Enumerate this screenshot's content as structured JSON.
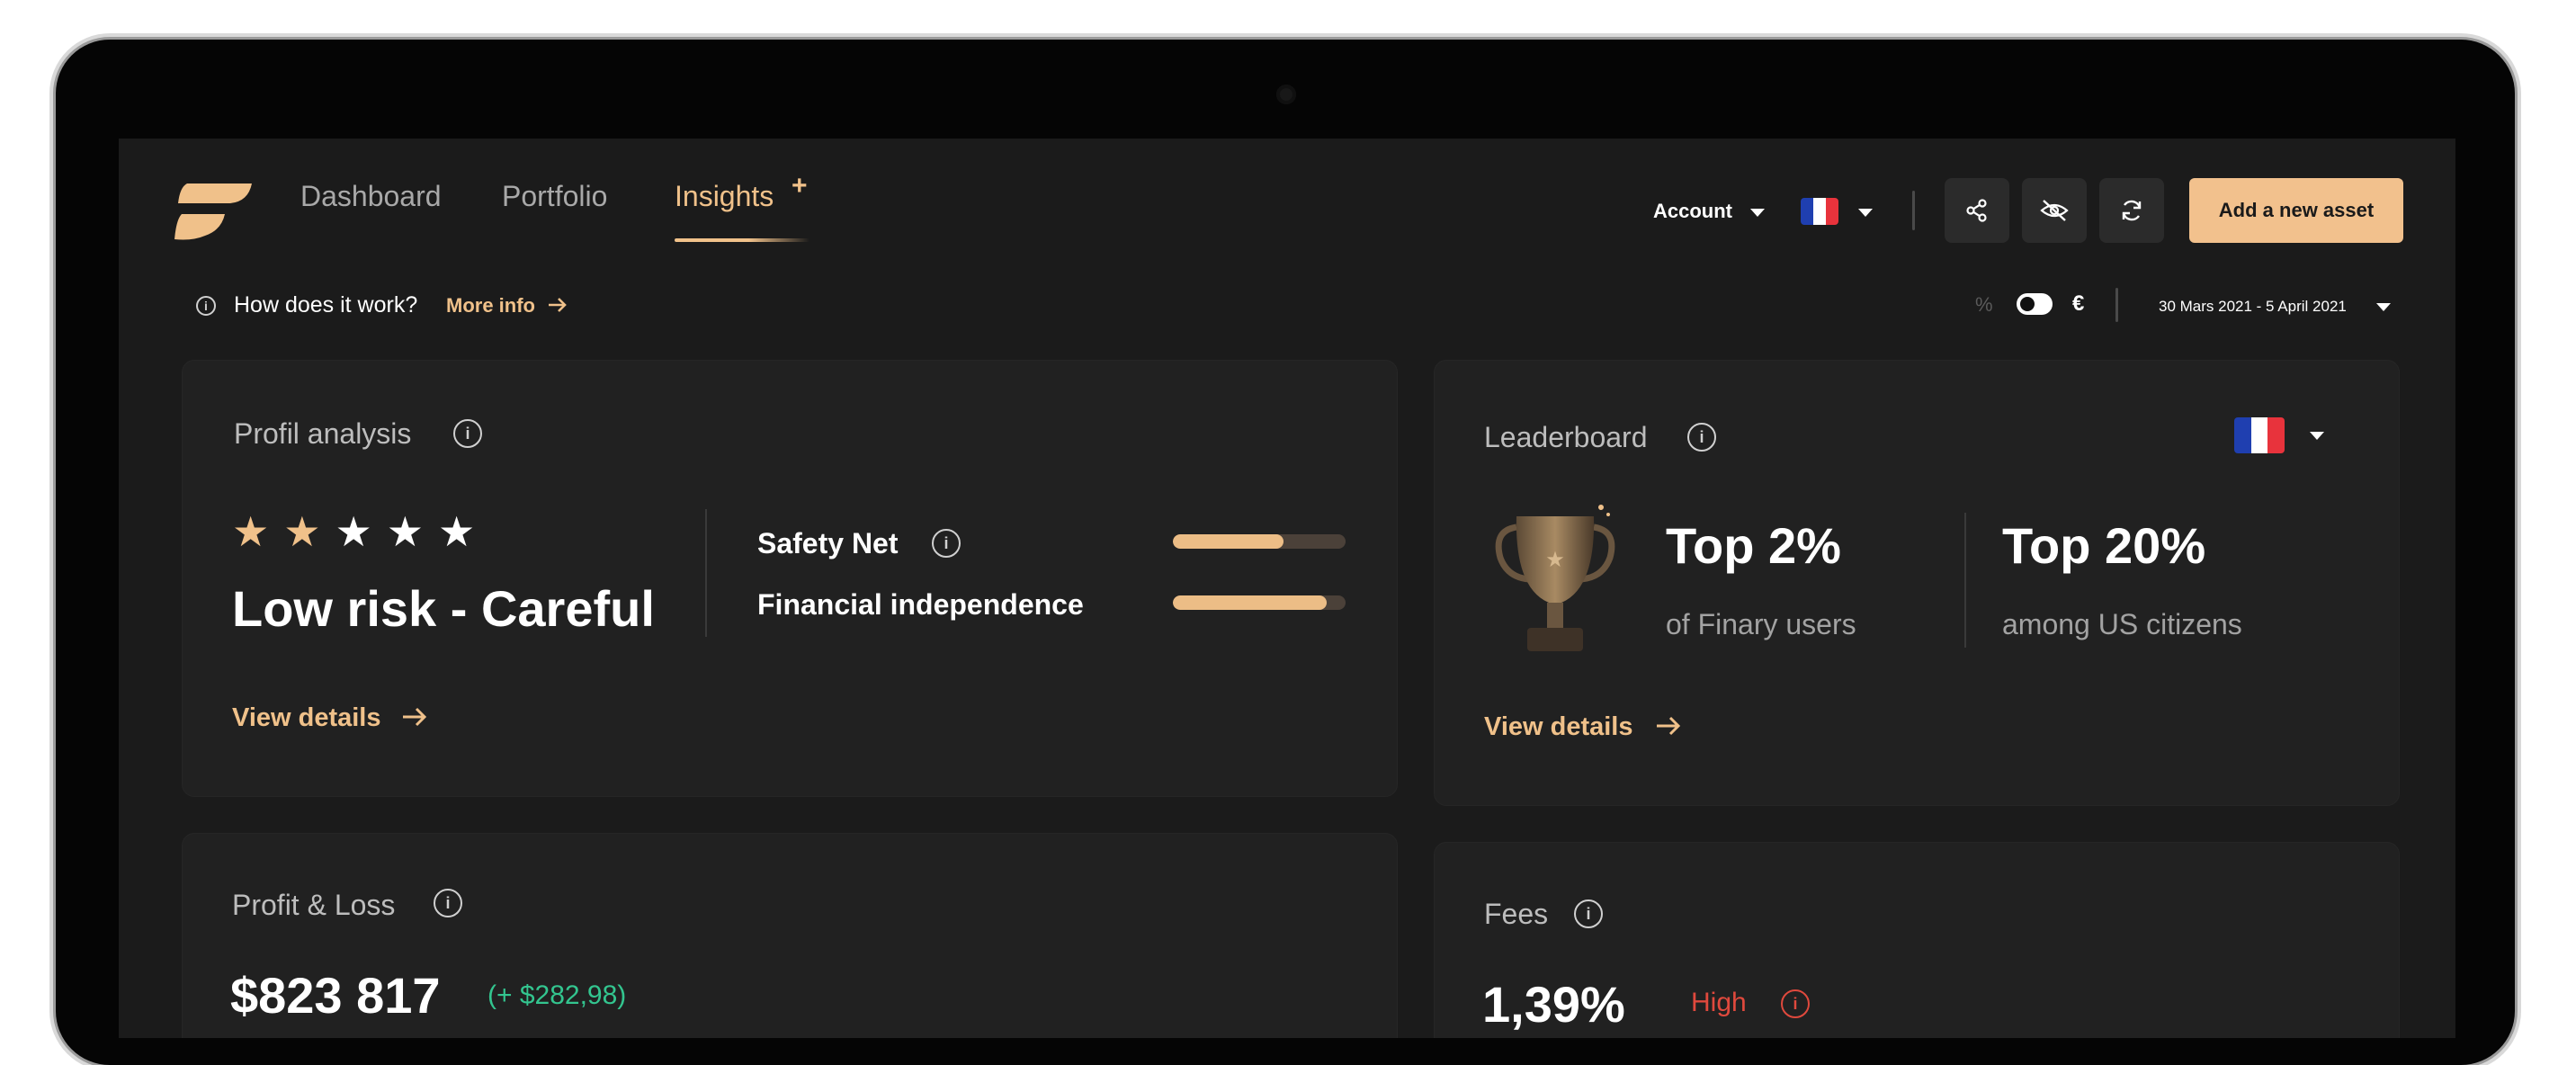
{
  "nav": {
    "items": [
      {
        "label": "Dashboard"
      },
      {
        "label": "Portfolio"
      },
      {
        "label": "Insights",
        "badge": "+"
      }
    ],
    "active": "Insights"
  },
  "header": {
    "account_label": "Account",
    "flag_country": "France",
    "icons": [
      "share-icon",
      "eye-off-icon",
      "refresh-icon"
    ],
    "cta_label": "Add a new asset"
  },
  "info_bar": {
    "question": "How does it work?",
    "more_info": "More info",
    "toggle_left": "%",
    "toggle_right": "€",
    "date_range": "30 Mars 2021 - 5 April 2021"
  },
  "profil": {
    "title": "Profil analysis",
    "rating": 2,
    "max_rating": 5,
    "risk_label": "Low risk - Careful",
    "metrics": [
      {
        "label": "Safety Net",
        "has_info": true,
        "progress": 0.64
      },
      {
        "label": "Financial independence",
        "has_info": false,
        "progress": 0.89
      }
    ],
    "link": "View details"
  },
  "leaderboard": {
    "title": "Leaderboard",
    "stats": [
      {
        "value": "Top 2%",
        "caption": "of Finary users"
      },
      {
        "value": "Top 20%",
        "caption": "among US citizens"
      }
    ],
    "link": "View details"
  },
  "pnl": {
    "title": "Profit & Loss",
    "value": "$823 817",
    "delta": "(+ $282,98)"
  },
  "fees": {
    "title": "Fees",
    "value": "1,39%",
    "level": "High"
  },
  "colors": {
    "accent": "#f0c18a",
    "positive": "#33c58f",
    "negative": "#e0493d",
    "background": "#1b1b1b",
    "card": "#212121"
  }
}
